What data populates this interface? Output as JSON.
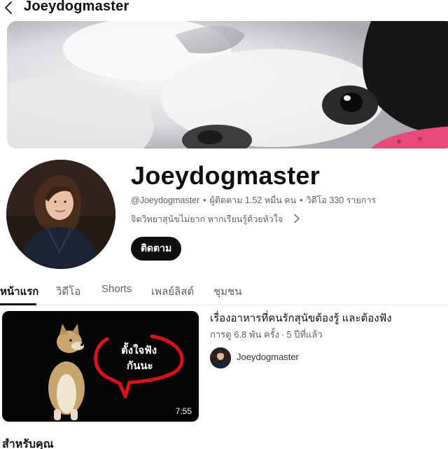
{
  "topbar": {
    "back_icon": "chevron-left-icon",
    "title": "Joeydogmaster"
  },
  "channel": {
    "name": "Joeydogmaster",
    "handle": "@Joeydogmaster",
    "subscribers": "ผู้ติดตาม 1.52 หมื่น คน",
    "videos": "วิดีโอ 330 รายการ",
    "description": "จิตวิทยาสุนัขไม่ยาก หากเรียนรู้ด้วยหัวใจ",
    "subscribe_label": "ติดตาม",
    "separator": "•"
  },
  "tabs": [
    {
      "label": "หน้าแรก",
      "active": true
    },
    {
      "label": "วิดีโอ",
      "active": false
    },
    {
      "label": "Shorts",
      "active": false
    },
    {
      "label": "เพลย์ลิสต์",
      "active": false
    },
    {
      "label": "ชุมชน",
      "active": false
    }
  ],
  "featured_video": {
    "title": "เรื่องอาหารที่คนรักสุนัขต้องรู้ และต้องฟัง",
    "views": "การดู 6.8 พัน ครั้ง",
    "age": "5 ปีที่แล้ว",
    "separator": "·",
    "duration": "7:55",
    "channel": "Joeydogmaster",
    "thumb_text_line1": "ตั้งใจฟัง",
    "thumb_text_line2": "กันนะ"
  },
  "section": {
    "title": "สำหรับคุณ"
  },
  "colors": {
    "text_primary": "#0f0f0f",
    "text_secondary": "#606060",
    "button_bg": "#0f0f0f",
    "thumb_accent": "#e0101a"
  }
}
